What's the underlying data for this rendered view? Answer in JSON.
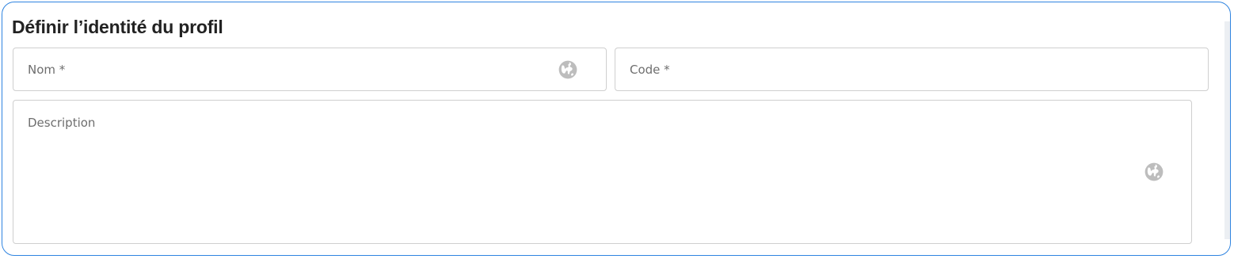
{
  "section": {
    "title": "Définir l’identité du profil"
  },
  "fields": {
    "nom": {
      "placeholder": "Nom *",
      "value": "",
      "icon": "globe-icon"
    },
    "code": {
      "placeholder": "Code *",
      "value": ""
    },
    "description": {
      "placeholder": "Description",
      "value": "",
      "icon": "globe-icon"
    }
  },
  "colors": {
    "panel_border": "#2f84e0",
    "field_border": "#cfcfcf",
    "icon": "#bdbdbd",
    "title": "#222222"
  }
}
